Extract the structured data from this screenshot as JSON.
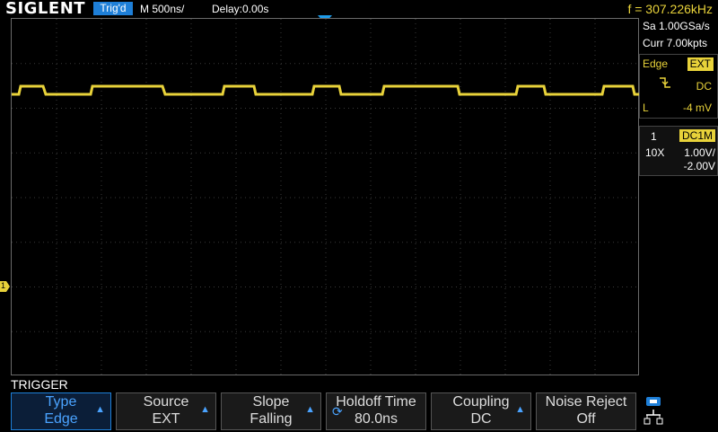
{
  "header": {
    "logo": "SIGLENT",
    "trigger_status": "Trig'd",
    "timebase": "M 500ns/",
    "delay": "Delay:0.00s",
    "frequency": "f = 307.226kHz"
  },
  "acquisition": {
    "sample_rate": "Sa 1.00GSa/s",
    "memory_depth": "Curr 7.00kpts"
  },
  "trigger_info": {
    "type": "Edge",
    "source": "EXT",
    "slope_icon": "falling-edge-icon",
    "coupling": "DC",
    "level_label": "L",
    "level_value": "-4 mV"
  },
  "channel_info": {
    "channel": "1",
    "coupling_impedance": "DC1M",
    "probe": "10X",
    "scale": "1.00V/",
    "offset": "-2.00V"
  },
  "markers": {
    "channel1_ground": "1"
  },
  "menu": {
    "title": "TRIGGER",
    "softkeys": [
      {
        "label": "Type",
        "value": "Edge"
      },
      {
        "label": "Source",
        "value": "EXT"
      },
      {
        "label": "Slope",
        "value": "Falling"
      },
      {
        "label": "Holdoff Time",
        "value": "80.0ns"
      },
      {
        "label": "Coupling",
        "value": "DC"
      },
      {
        "label": "Noise Reject",
        "value": "Off"
      }
    ]
  },
  "colors": {
    "channel1": "#e8d23a",
    "accent": "#1e7fd8",
    "grid": "#3a3a3a"
  }
}
